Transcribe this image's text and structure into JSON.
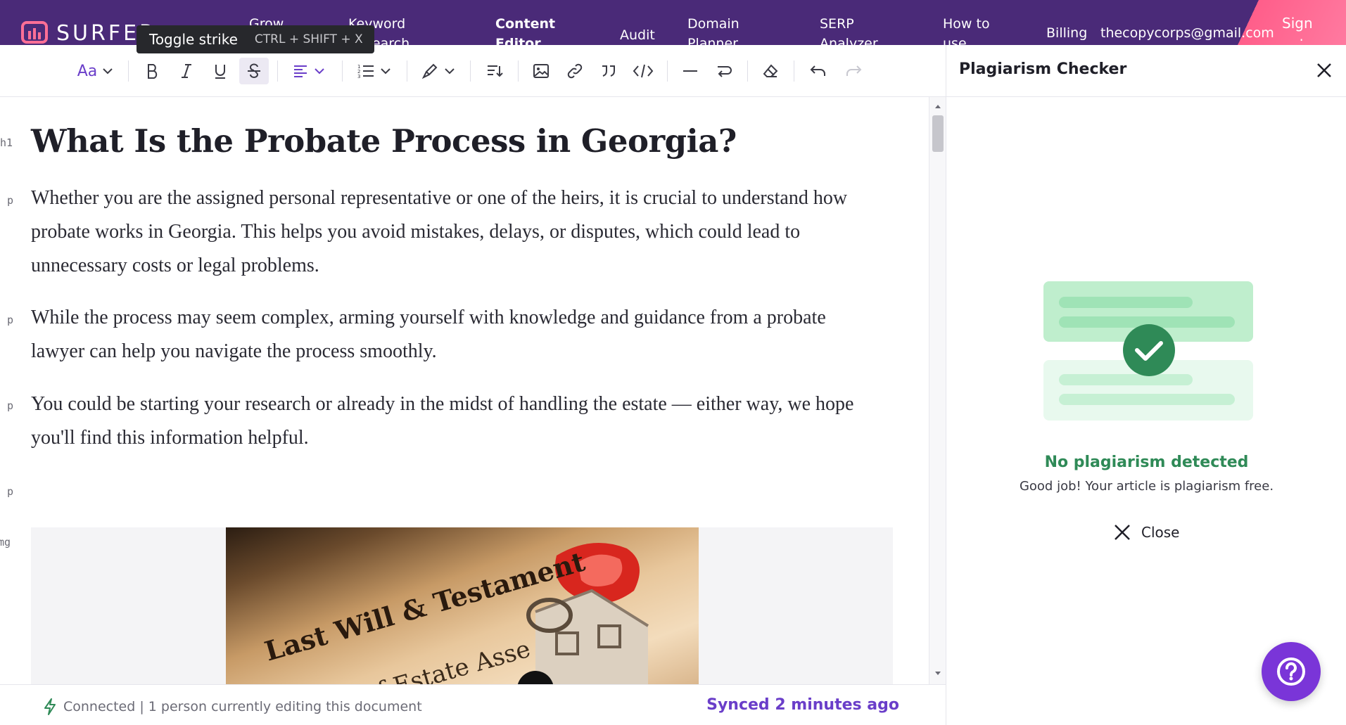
{
  "topnav": {
    "logo_text": "SURFER",
    "items": [
      {
        "label": "Grow"
      },
      {
        "label": "Keyword Research"
      },
      {
        "label": "Content Editor"
      },
      {
        "label": "Audit"
      },
      {
        "label": "Domain Planner"
      },
      {
        "label": "SERP Analyzer"
      },
      {
        "label": "How to use"
      },
      {
        "label": "Billing"
      }
    ],
    "email": "thecopycorps@gmail.com",
    "sign_label": "Sign out",
    "colors": {
      "bg": "#4a2a78",
      "accent": "#ff6f96"
    }
  },
  "tooltip": {
    "label": "Toggle strike",
    "shortcut": "CTRL + SHIFT + X"
  },
  "toolbar": {
    "text_style_label": "Aa",
    "buttons": [
      "text-style",
      "bold",
      "italic",
      "underline",
      "strikethrough",
      "align",
      "list",
      "highlight",
      "line-height",
      "image",
      "link",
      "quote",
      "code",
      "horizontal-rule",
      "hard-break",
      "clear-format",
      "undo",
      "redo"
    ]
  },
  "editor": {
    "tags": {
      "h1": "h1",
      "p": "p",
      "img": "img"
    },
    "heading": "What Is the Probate Process in Georgia?",
    "paragraphs": [
      "Whether you are the assigned personal representative or one of the heirs, it is crucial to understand how probate works in Georgia. This helps you avoid mistakes, delays, or disputes, which could lead to unnecessary costs or legal problems.",
      "While the process may seem complex, arming yourself with knowledge and guidance from a probate lawyer can help you navigate the process smoothly.",
      "You could be starting your research or already in the midst of handling the estate — either way, we hope you'll find this information helpful."
    ],
    "image_text": {
      "line1": "Last Will & Testament",
      "line2": "of Estate  Asse"
    }
  },
  "status": {
    "connection": "Connected | 1 person currently editing this document",
    "synced": "Synced 2 minutes ago"
  },
  "panel": {
    "title": "Plagiarism Checker",
    "result_title": "No plagiarism detected",
    "result_sub": "Good job! Your article is plagiarism free.",
    "close_label": "Close",
    "colors": {
      "success": "#2f8a57",
      "light": "#bfeecd",
      "lighter": "#e8f9ee"
    }
  },
  "help_icon": "question-icon"
}
